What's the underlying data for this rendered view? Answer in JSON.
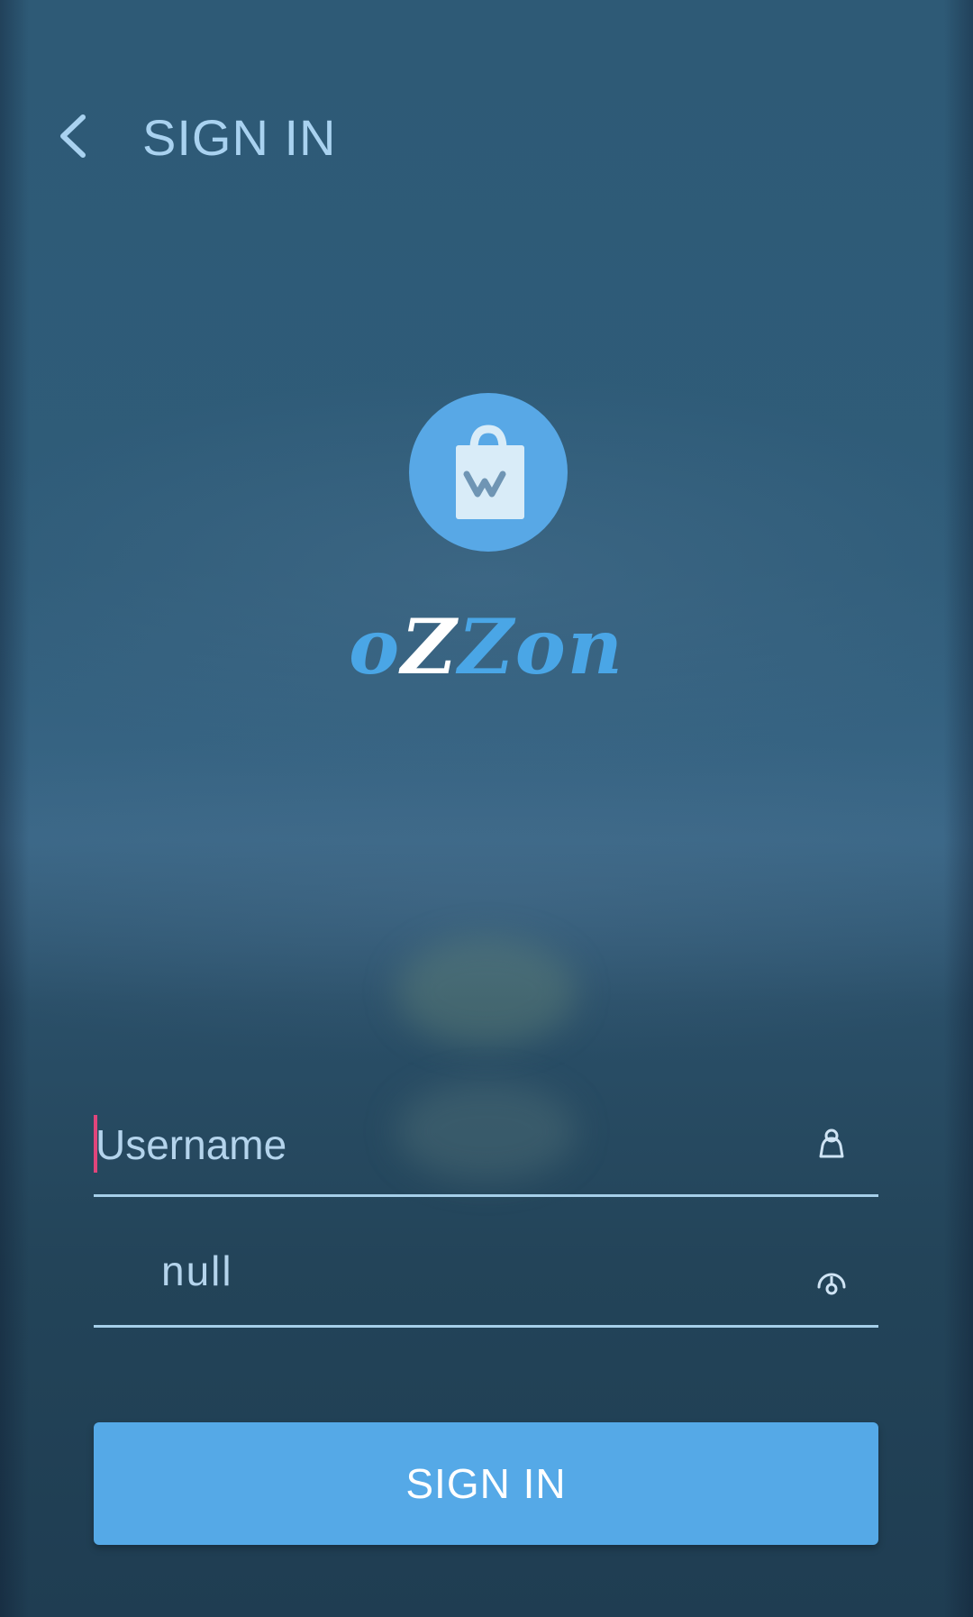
{
  "header": {
    "title": "SIGN IN",
    "back_icon": "chevron-left-icon"
  },
  "brand": {
    "logo_icon": "shopping-bag-icon",
    "name_part1": "o",
    "name_part2": "Z",
    "name_part3": "Zon"
  },
  "form": {
    "username": {
      "value": "",
      "placeholder": "Username",
      "icon": "person-icon"
    },
    "password": {
      "value": "",
      "placeholder": "null",
      "icon": "lock-icon"
    },
    "submit_label": "SIGN IN"
  },
  "colors": {
    "accent": "#55a9e7",
    "cursor": "#e0457b",
    "text_light": "#a9d2f0",
    "background": "#2e5a76"
  }
}
